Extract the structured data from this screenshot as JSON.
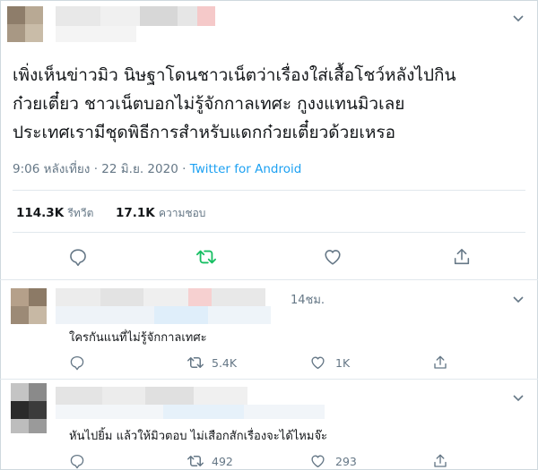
{
  "tweet": {
    "text_lines": [
      "เพิ่งเห็นข่าวมิว นิษฐาโดนชาวเน็ตว่าเรื่องใส่เสื้อโชว์หลังไปกิน",
      "ก๋วยเตี๋ยว ชาวเน็ตบอกไม่รู้จักกาลเทศะ กูงงแทนมิวเลย",
      "ประเทศเรามีชุดพิธีการสำหรับแดกก๋วยเตี๋ยวด้วยเหรอ"
    ],
    "time": "9:06 หลังเที่ยง",
    "sep": "·",
    "date": "22 มิ.ย. 2020",
    "source": "Twitter for Android",
    "retweets_count": "114.3K",
    "retweets_label": "รีทวีต",
    "likes_count": "17.1K",
    "likes_label": "ความชอบ"
  },
  "replies": [
    {
      "time": "14ชม.",
      "text": "ใครกันแนที่ไม่รู้จักกาลเทศะ",
      "retweets": "5.4K",
      "likes": "1K"
    },
    {
      "text": "หันไปยิ้ม แล้วให้มิวตอบ ไม่เสือกสักเรื่องจะได้ไหมจ๊ะ",
      "retweets": "492",
      "likes": "293"
    }
  ],
  "colors": {
    "text": "#14171a",
    "muted": "#657786",
    "link": "#1da1f2",
    "retweet_active": "#17bf63",
    "border": "#e1e8ed"
  },
  "icons": [
    "chevron-down-icon",
    "reply-icon",
    "retweet-icon",
    "like-icon",
    "share-icon"
  ]
}
